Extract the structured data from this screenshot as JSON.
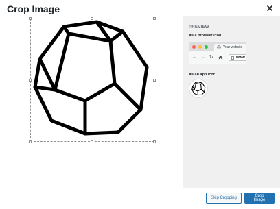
{
  "dialog": {
    "title": "Crop Image",
    "close_icon": "close-icon"
  },
  "editor": {
    "image_icon": "dodecahedron-outline"
  },
  "sidebar": {
    "heading": "PREVIEW",
    "browser_label": "As a browser icon",
    "tab_title": "Your website",
    "url_text": "www.",
    "app_label": "As an app icon"
  },
  "footer": {
    "skip_label": "Skip Cropping",
    "crop_label": "Crop Image"
  },
  "colors": {
    "accent": "#2271b1",
    "traffic_red": "#ff5f57",
    "traffic_yellow": "#febc2e",
    "traffic_green": "#28c840"
  }
}
